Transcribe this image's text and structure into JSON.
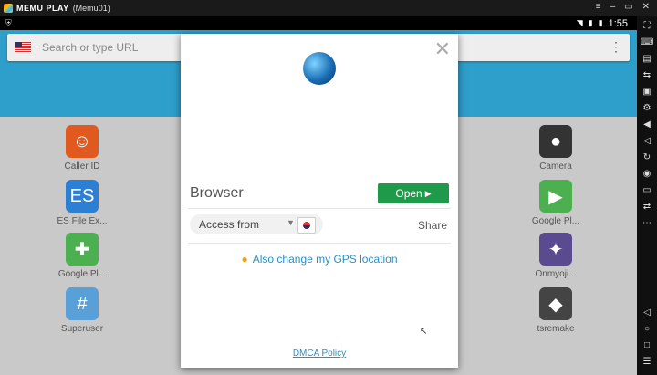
{
  "titlebar": {
    "brand": "MEMU PLAY",
    "instance": "(Memu01)"
  },
  "statusbar": {
    "time": "1:55"
  },
  "searchbar": {
    "placeholder": "Search or type URL",
    "menu_glyph": "⋮"
  },
  "apps": [
    {
      "label": "Caller ID",
      "icon": "caller-id-icon",
      "glyph": "☺",
      "color": "#e05a20"
    },
    {
      "label": "ES File Ex...",
      "icon": "es-file-explorer-icon",
      "glyph": "ES",
      "color": "#2d7fd3"
    },
    {
      "label": "Google Pl...",
      "icon": "google-play-services-icon",
      "glyph": "✚",
      "color": "#4caf50"
    },
    {
      "label": "Superuser",
      "icon": "superuser-icon",
      "glyph": "#",
      "color": "#5aa0d8"
    },
    {
      "label": "Camera",
      "icon": "camera-icon",
      "glyph": "●",
      "color": "#333"
    },
    {
      "label": "Google Pl...",
      "icon": "google-play-store-icon",
      "glyph": "▶",
      "color": "#4caf50"
    },
    {
      "label": "Onmyoji...",
      "icon": "onmyoji-icon",
      "glyph": "✦",
      "color": "#5a4a90"
    },
    {
      "label": "tsremake",
      "icon": "unity-icon",
      "glyph": "◆",
      "color": "#444"
    }
  ],
  "dialog": {
    "app_name": "Browser",
    "open_label": "Open",
    "access_label": "Access from",
    "share_label": "Share",
    "gps_label": "Also change my GPS location",
    "dmca_label": "DMCA Policy"
  }
}
